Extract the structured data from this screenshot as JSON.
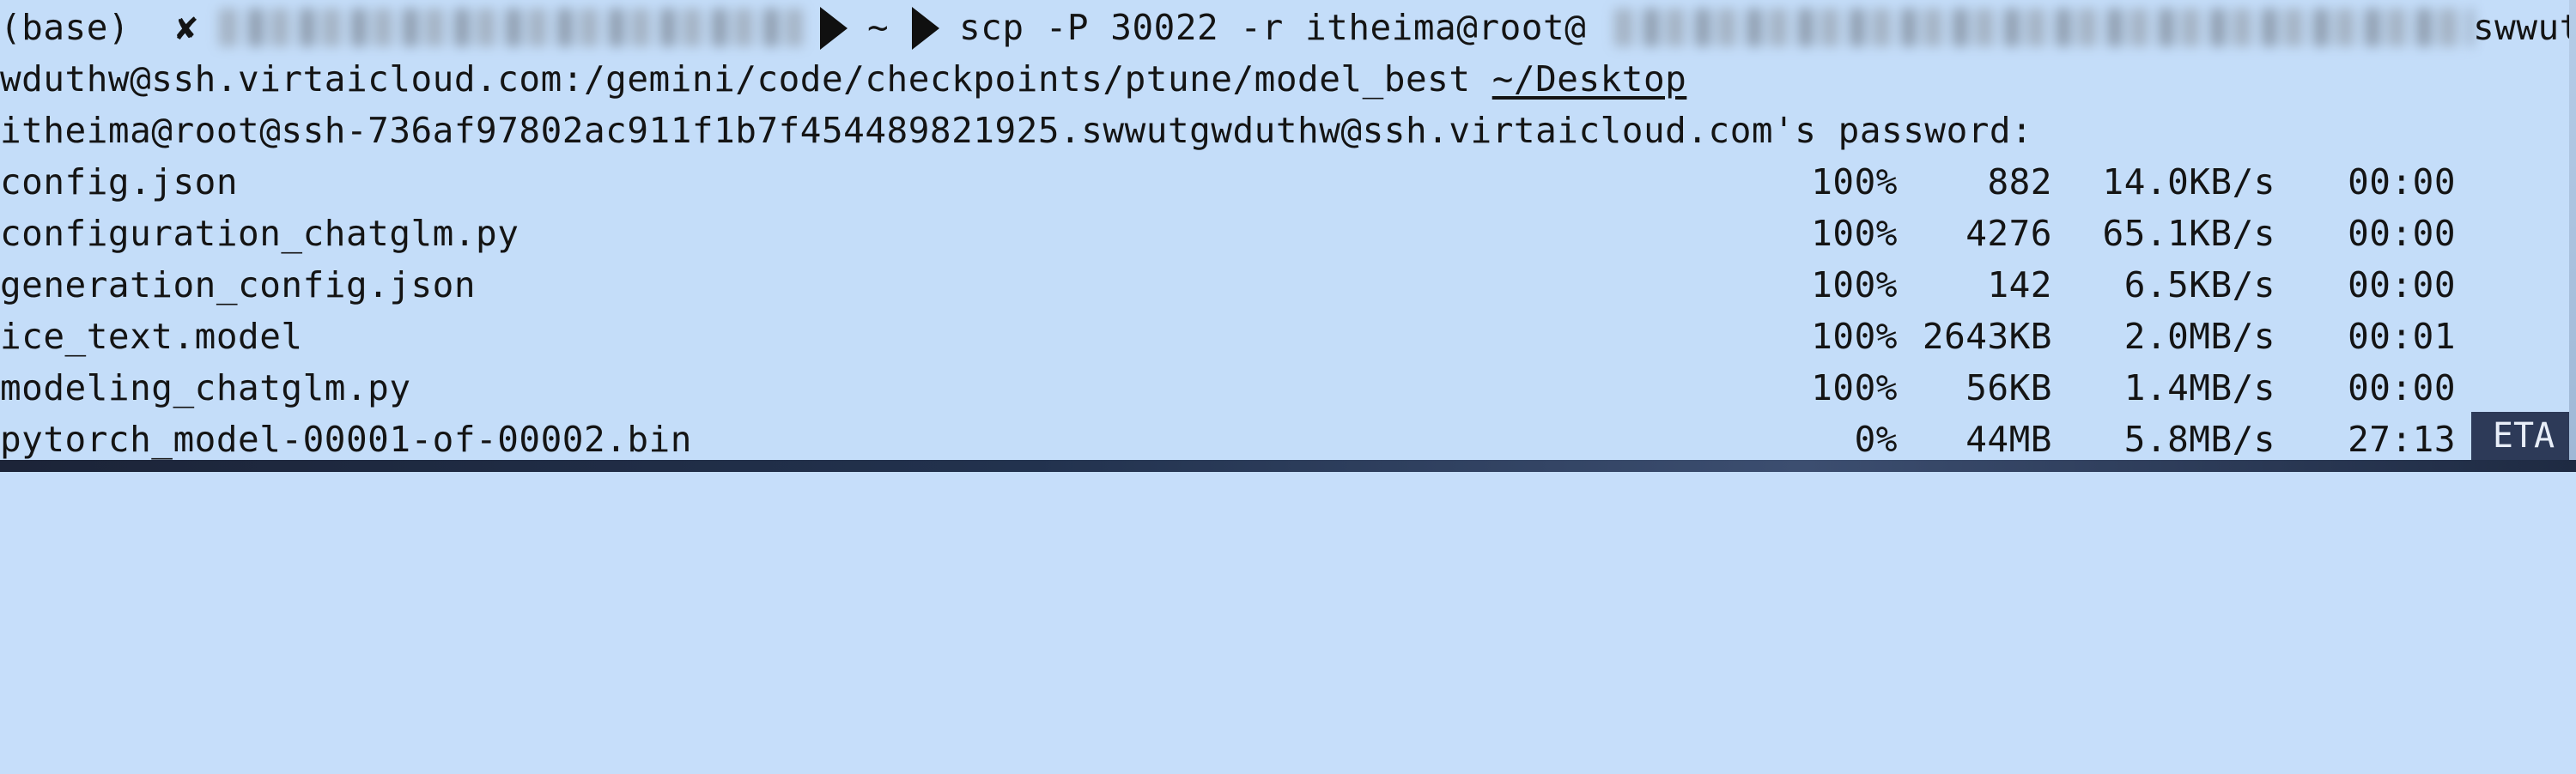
{
  "terminal": {
    "prompt": {
      "env": "(base)",
      "status_mark": "✘",
      "host_blurred": "user@MacBook-Pro",
      "cwd": "~"
    },
    "command": {
      "line1": "scp -P 30022 -r itheima@root@",
      "line1_tail": "swwutg",
      "line2_path": "wduthw@ssh.virtaicloud.com:/gemini/code/checkpoints/ptune/model_best ",
      "line2_dest": "~/Desktop"
    },
    "password_prompt": "itheima@root@ssh-736af97802ac911f1b7f454489821925.swwutgwduthw@ssh.virtaicloud.com's password:",
    "transfers": [
      {
        "name": "config.json",
        "percent": "100%",
        "size": "882",
        "rate": "14.0KB/s",
        "time": "00:00"
      },
      {
        "name": "configuration_chatglm.py",
        "percent": "100%",
        "size": "4276",
        "rate": "65.1KB/s",
        "time": "00:00"
      },
      {
        "name": "generation_config.json",
        "percent": "100%",
        "size": "142",
        "rate": "6.5KB/s",
        "time": "00:00"
      },
      {
        "name": "ice_text.model",
        "percent": "100%",
        "size": "2643KB",
        "rate": "2.0MB/s",
        "time": "00:01"
      },
      {
        "name": "modeling_chatglm.py",
        "percent": "100%",
        "size": "56KB",
        "rate": "1.4MB/s",
        "time": "00:00"
      },
      {
        "name": "pytorch_model-00001-of-00002.bin",
        "percent": "0%",
        "size": "44MB",
        "rate": "5.8MB/s",
        "time": "27:13"
      }
    ],
    "eta_label": "ETA"
  }
}
